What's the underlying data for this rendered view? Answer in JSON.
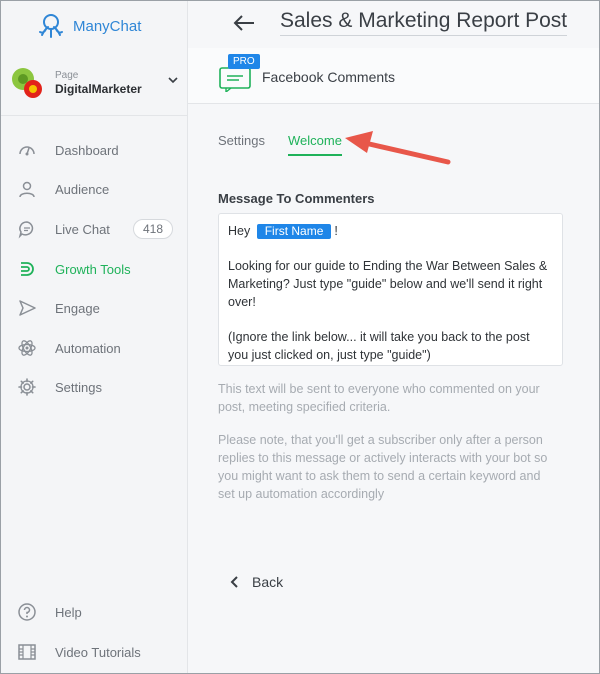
{
  "brand": {
    "name": "ManyChat"
  },
  "page_switcher": {
    "label": "Page",
    "name": "DigitalMarketer"
  },
  "nav": [
    {
      "label": "Dashboard",
      "icon": "dashboard-icon"
    },
    {
      "label": "Audience",
      "icon": "user-icon"
    },
    {
      "label": "Live Chat",
      "icon": "chat-icon",
      "badge": "418"
    },
    {
      "label": "Growth Tools",
      "icon": "magnet-icon",
      "active": true
    },
    {
      "label": "Engage",
      "icon": "send-icon"
    },
    {
      "label": "Automation",
      "icon": "atom-icon"
    },
    {
      "label": "Settings",
      "icon": "gear-icon"
    }
  ],
  "footer_nav": [
    {
      "label": "Help",
      "icon": "help-icon"
    },
    {
      "label": "Video Tutorials",
      "icon": "film-icon"
    }
  ],
  "header": {
    "title": "Sales & Marketing Report Post"
  },
  "widget": {
    "badge": "PRO",
    "title": "Facebook Comments"
  },
  "tabs": {
    "settings": "Settings",
    "welcome": "Welcome"
  },
  "message": {
    "section_label": "Message To Commenters",
    "greeting_before": "Hey",
    "first_name_chip": "First Name",
    "greeting_after": "!",
    "para1": "Looking for our guide to Ending the War Between Sales & Marketing?  Just type \"guide\" below and we'll send it right over!",
    "para2": "(Ignore the link below... it will take you back to the post you just clicked on, just type \"guide\")"
  },
  "hints": {
    "h1": "This text will be sent to everyone who commented on your post, meeting specified criteria.",
    "h2": "Please note, that you'll get a subscriber only after a person replies to this message or actively interacts with your bot so you might want to ask them to send a certain keyword and set up automation accordingly"
  },
  "back": {
    "label": "Back"
  },
  "colors": {
    "accent_green": "#1fb25a",
    "accent_blue": "#1f86e8",
    "annotation_red": "#e8574a"
  }
}
